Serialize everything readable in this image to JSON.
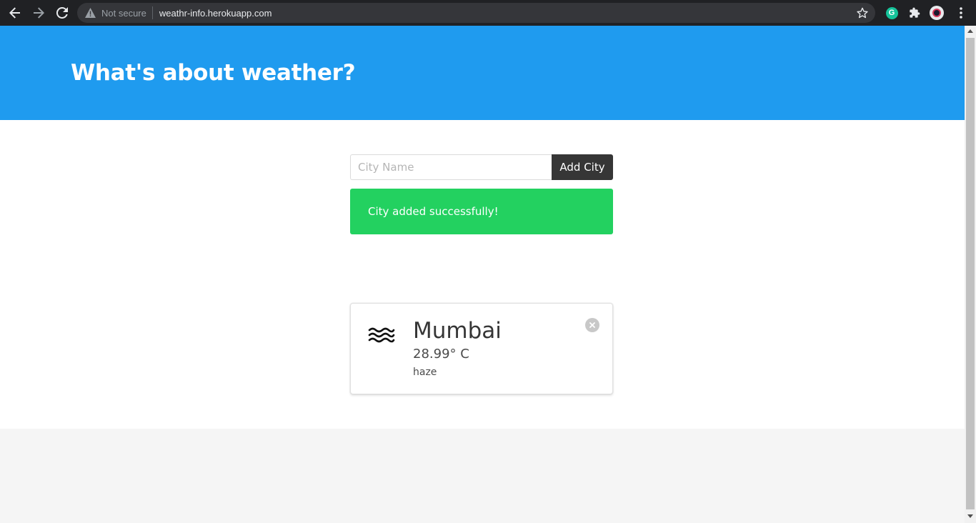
{
  "browser": {
    "security_label": "Not secure",
    "url": "weathr-info.herokuapp.com",
    "icons": [
      "back-arrow-icon",
      "forward-arrow-icon",
      "reload-icon",
      "warning-icon",
      "star-icon",
      "grammarly-icon",
      "puzzle-icon",
      "profile-icon",
      "more-icon"
    ],
    "grammarly_letter": "G"
  },
  "header": {
    "title": "What's about weather?"
  },
  "form": {
    "input_placeholder": "City Name",
    "input_value": "",
    "add_button_label": "Add City"
  },
  "notification": {
    "message": "City added successfully!"
  },
  "cards": [
    {
      "icon": "haze-waves-icon",
      "city": "Mumbai",
      "temperature": "28.99° C",
      "description": "haze"
    }
  ],
  "colors": {
    "hero": "#1f9bef",
    "success": "#23d160",
    "button_dark": "#363636",
    "footer": "#f5f5f5"
  }
}
